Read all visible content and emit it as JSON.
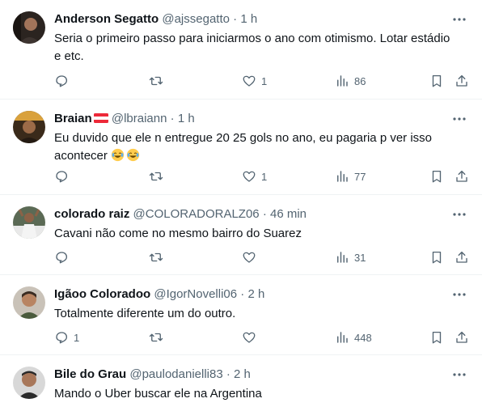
{
  "tweets": [
    {
      "name": "Anderson Segatto",
      "handle": "@ajssegatto",
      "separator": "·",
      "time": "1 h",
      "text": "Seria o primeiro passo para iniciarmos o ano com otimismo. Lotar estádio e etc.",
      "replies": "",
      "retweets": "",
      "likes": "1",
      "views": "86"
    },
    {
      "name": "Braian",
      "handle": "@lbraiann",
      "separator": "·",
      "time": "1 h",
      "text": "Eu duvido que ele n entregue 20 25 gols no ano, eu pagaria p ver isso acontecer",
      "replies": "",
      "retweets": "",
      "likes": "1",
      "views": "77"
    },
    {
      "name": "colorado raiz",
      "handle": "@COLORADORALZ06",
      "separator": "·",
      "time": "46 min",
      "text": "Cavani não come no mesmo bairro do Suarez",
      "replies": "",
      "retweets": "",
      "likes": "",
      "views": "31"
    },
    {
      "name": "Igãoo Coloradoo",
      "handle": "@IgorNovelli06",
      "separator": "·",
      "time": "2 h",
      "text": "Totalmente diferente um do outro.",
      "replies": "1",
      "retweets": "",
      "likes": "",
      "views": "448"
    },
    {
      "name": "Bile do Grau",
      "handle": "@paulodanielli83",
      "separator": "·",
      "time": "2 h",
      "text": "Mando o Uber buscar ele na Argentina",
      "replies": "",
      "retweets": "",
      "likes": "",
      "views": ""
    }
  ],
  "icons": {
    "reply": "reply-icon",
    "retweet": "retweet-icon",
    "like": "heart-icon",
    "views": "views-icon",
    "bookmark": "bookmark-icon",
    "share": "share-icon",
    "more": "more-icon",
    "emoji": "joy-emoji-icon",
    "flag": "austria-flag-icon"
  },
  "colors": {
    "text": "#0f1419",
    "secondary": "#536471",
    "divider": "#eff3f4"
  }
}
